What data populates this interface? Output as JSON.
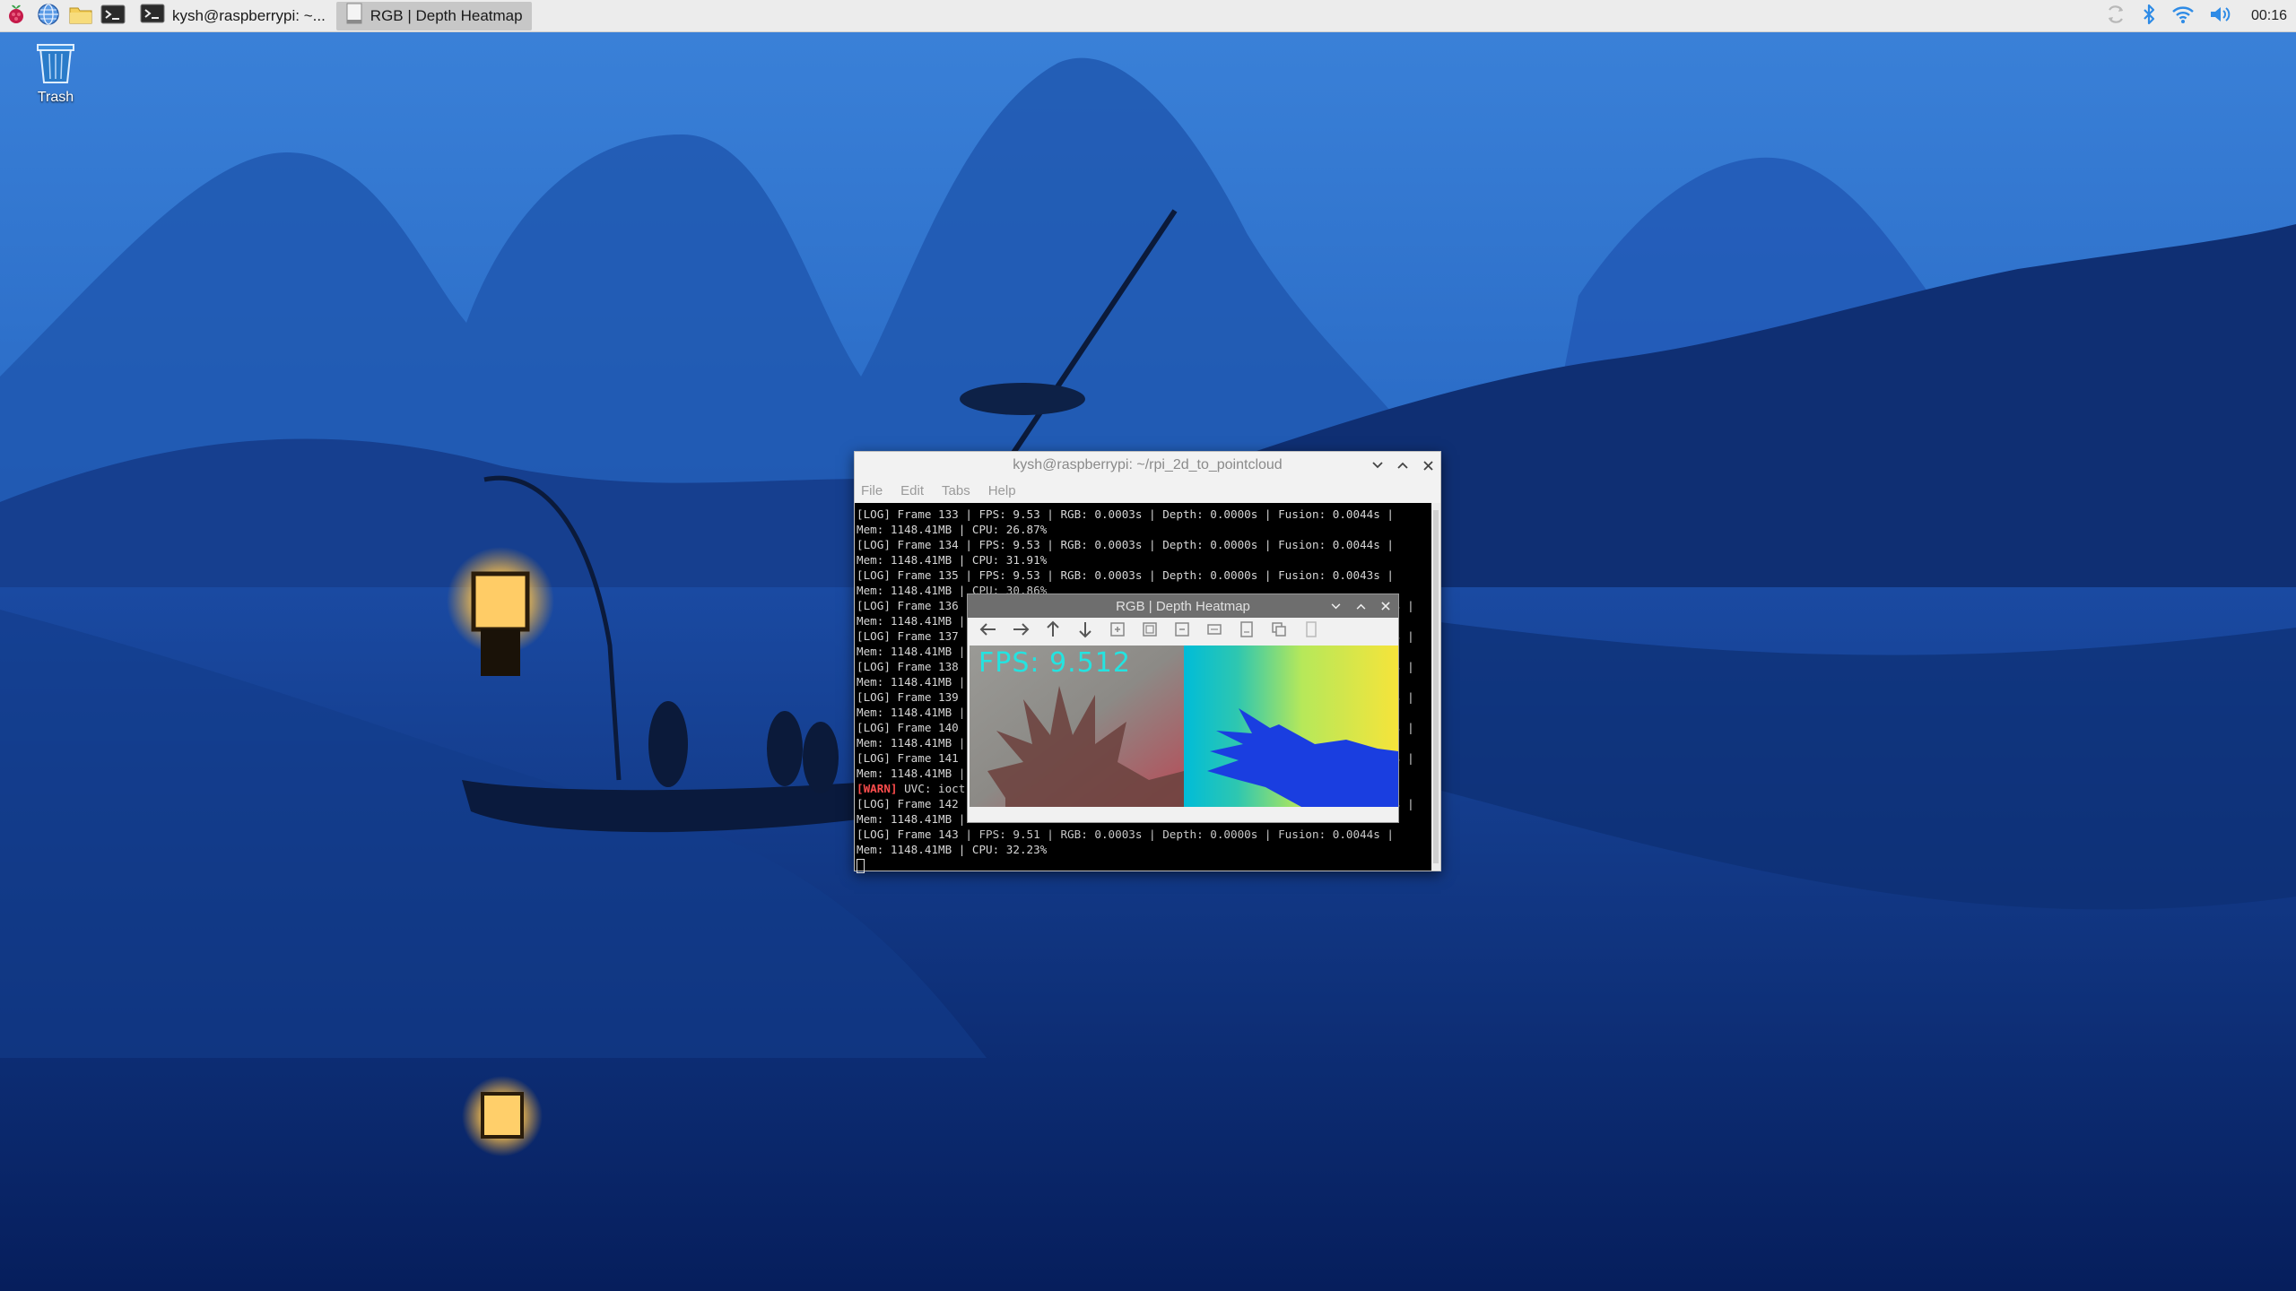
{
  "taskbar": {
    "tasks": [
      {
        "label": "kysh@raspberrypi: ~..."
      },
      {
        "label": "RGB | Depth Heatmap"
      }
    ],
    "clock": "00:16"
  },
  "desktop": {
    "trash_label": "Trash"
  },
  "terminal": {
    "title": "kysh@raspberrypi: ~/rpi_2d_to_pointcloud",
    "menu": [
      "File",
      "Edit",
      "Tabs",
      "Help"
    ],
    "lines": [
      "[LOG] Frame 133 | FPS: 9.53 | RGB: 0.0003s | Depth: 0.0000s | Fusion: 0.0044s |",
      "Mem: 1148.41MB | CPU: 26.87%",
      "[LOG] Frame 134 | FPS: 9.53 | RGB: 0.0003s | Depth: 0.0000s | Fusion: 0.0044s |",
      "Mem: 1148.41MB | CPU: 31.91%",
      "[LOG] Frame 135 | FPS: 9.53 | RGB: 0.0003s | Depth: 0.0000s | Fusion: 0.0043s |",
      "Mem: 1148.41MB | CPU: 30.86%",
      "[LOG] Frame 136                                                                s |",
      "Mem: 1148.41MB |",
      "[LOG] Frame 137                                                                s |",
      "Mem: 1148.41MB |",
      "[LOG] Frame 138                                                                s |",
      "Mem: 1148.41MB |",
      "[LOG] Frame 139                                                                s |",
      "Mem: 1148.41MB |",
      "[LOG] Frame 140                                                                s |",
      "Mem: 1148.41MB |",
      "[LOG] Frame 141                                                                s |",
      "Mem: 1148.41MB |",
      "[WARN]",
      "[LOG] Frame 142                                                                s |",
      "Mem: 1148.41MB |",
      "[LOG] Frame 143 | FPS: 9.51 | RGB: 0.0003s | Depth: 0.0000s | Fusion: 0.0044s |",
      "Mem: 1148.41MB | CPU: 32.23%"
    ],
    "warn_tag": "[WARN]",
    "warn_text": " UVC: ioct"
  },
  "heatmap_window": {
    "title": "RGB | Depth Heatmap",
    "fps_overlay": "FPS: 9.512"
  },
  "colors": {
    "accent": "#2e8be6",
    "fps_text": "#24e3e0",
    "warn": "#ff4d4d"
  },
  "icons": {
    "taskbar": [
      "raspberry-icon",
      "browser-icon",
      "file-manager-icon",
      "terminal-icon"
    ],
    "tray": [
      "sync-icon",
      "bluetooth-icon",
      "wifi-icon",
      "volume-icon"
    ],
    "heatmap_toolbar": [
      "back-arrow-icon",
      "forward-arrow-icon",
      "up-arrow-icon",
      "down-arrow-icon",
      "zoom-in-icon",
      "zoom-fit-icon",
      "zoom-out-icon",
      "pan-icon",
      "save-icon",
      "copy-icon",
      "properties-icon"
    ]
  }
}
